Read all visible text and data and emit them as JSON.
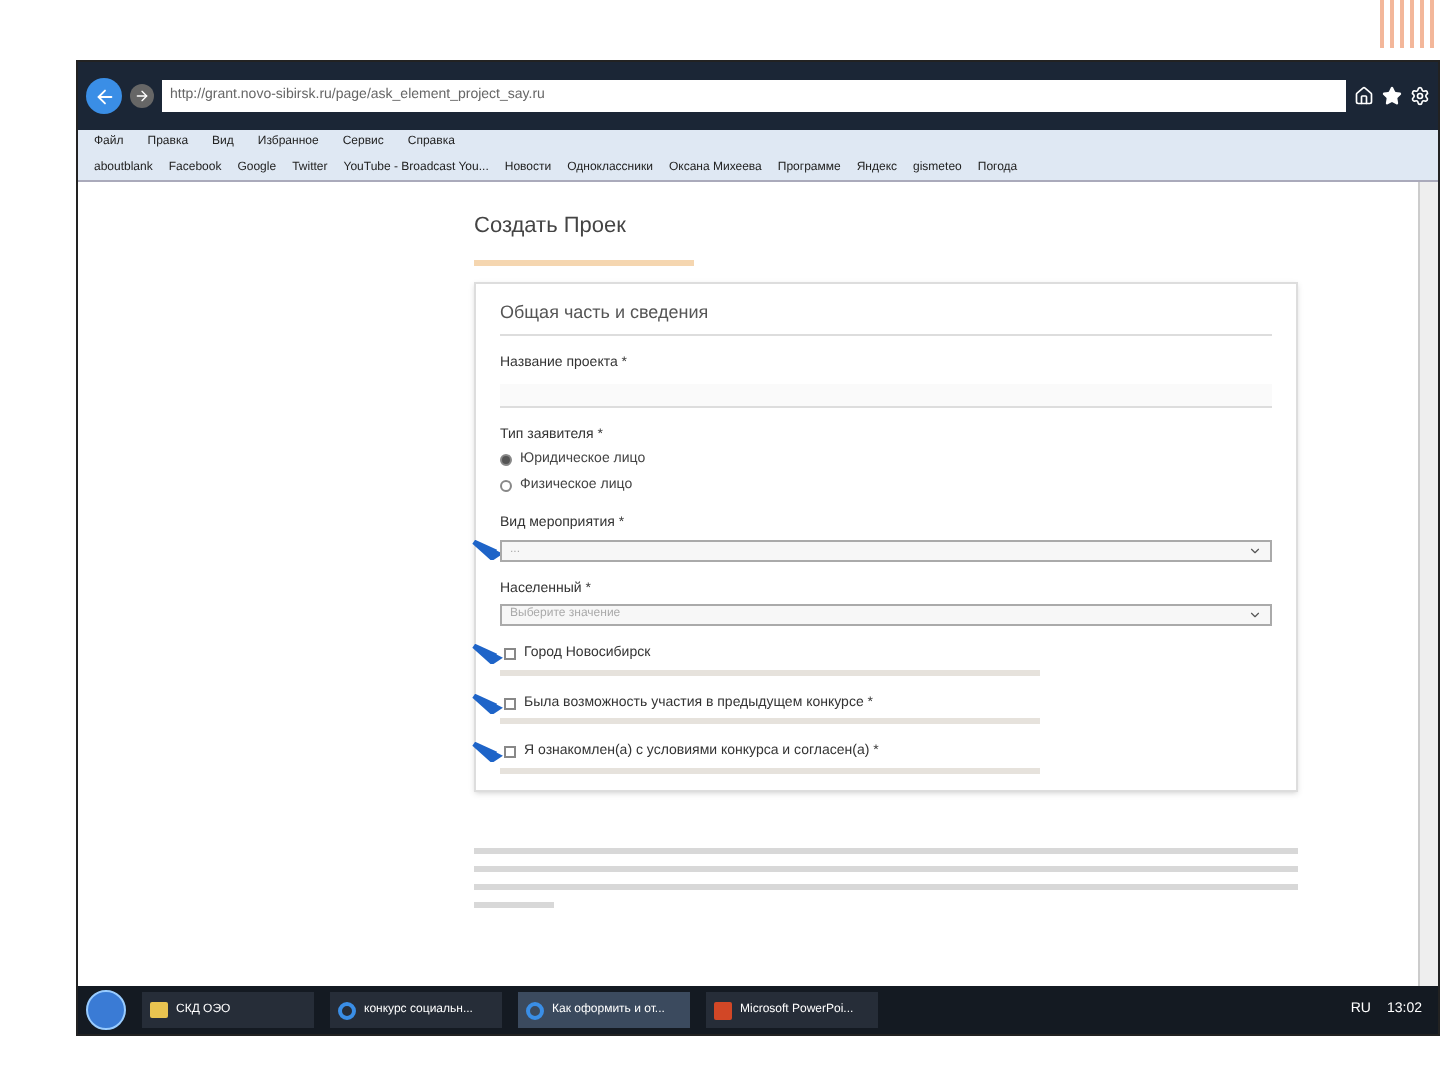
{
  "browser": {
    "url": "http://grant.novo-sibirsk.ru/page/ask_element_project_say.ru",
    "menu": [
      "Файл",
      "Правка",
      "Вид",
      "Избранное",
      "Сервис",
      "Справка"
    ],
    "bookmarks": [
      "aboutblank",
      "Facebook",
      "Google",
      "Twitter",
      "YouTube - Broadcast You...",
      "Новости",
      "Одноклассники",
      "Оксана Михеева",
      "Программе",
      "Яндекс",
      "gismeteo",
      "Погода"
    ]
  },
  "page": {
    "title": "Создать Проек",
    "form_title": "Общая часть и сведения",
    "fields": [
      {
        "kind": "text",
        "label": "Название проекта *"
      },
      {
        "kind": "radio",
        "label": "Тип заявителя *",
        "options": [
          {
            "label": "Юридическое лицо",
            "selected": true
          },
          {
            "label": "Физическое лицо",
            "selected": false
          }
        ]
      },
      {
        "kind": "select",
        "label": "Вид мероприятия *",
        "value": "...",
        "marked": true
      },
      {
        "kind": "select",
        "label": "Населенный *",
        "value": "Выберите значение",
        "marked": false
      },
      {
        "kind": "check",
        "label": "Город Новосибирск",
        "marked": true,
        "checked": false
      },
      {
        "kind": "check",
        "label": "Была возможность участия в предыдущем конкурсе *",
        "marked": true,
        "checked": false
      },
      {
        "kind": "check",
        "label": "Я ознакомлен(а) с условиями конкурса и согласен(а) *",
        "marked": true,
        "checked": false
      }
    ]
  },
  "taskbar": {
    "tasks": [
      {
        "label": "СКД ОЭО",
        "kind": "folder",
        "selected": false
      },
      {
        "label": "конкурс социальн...",
        "kind": "web",
        "selected": false
      },
      {
        "label": "Как оформить и от...",
        "kind": "web",
        "selected": true
      },
      {
        "label": "Microsoft PowerPoi...",
        "kind": "slides",
        "selected": false
      }
    ],
    "lang": "RU",
    "time": "13:02"
  }
}
